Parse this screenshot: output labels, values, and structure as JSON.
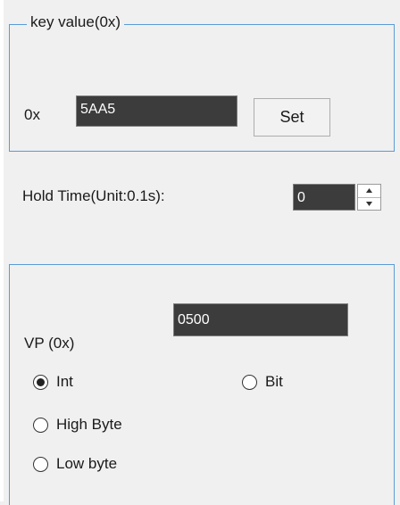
{
  "key_group": {
    "title": "key value(0x)",
    "prefix": "0x",
    "value": "5AA5",
    "set_label": "Set"
  },
  "hold_time": {
    "label": "Hold Time(Unit:0.1s):",
    "value": "0"
  },
  "vp_group": {
    "label": "VP (0x)",
    "value": "0500"
  },
  "options": {
    "int_label": "Int",
    "bit_label": "Bit",
    "high_label": "High Byte",
    "low_label": "Low byte",
    "selected": "Int"
  },
  "icons": {
    "spin_up": "triangle-up",
    "spin_down": "triangle-down"
  },
  "colors": {
    "group_border": "#5a9bd5",
    "input_background": "#3c3c3c",
    "input_text": "#ffffff",
    "window_background": "#f0f0f0"
  }
}
